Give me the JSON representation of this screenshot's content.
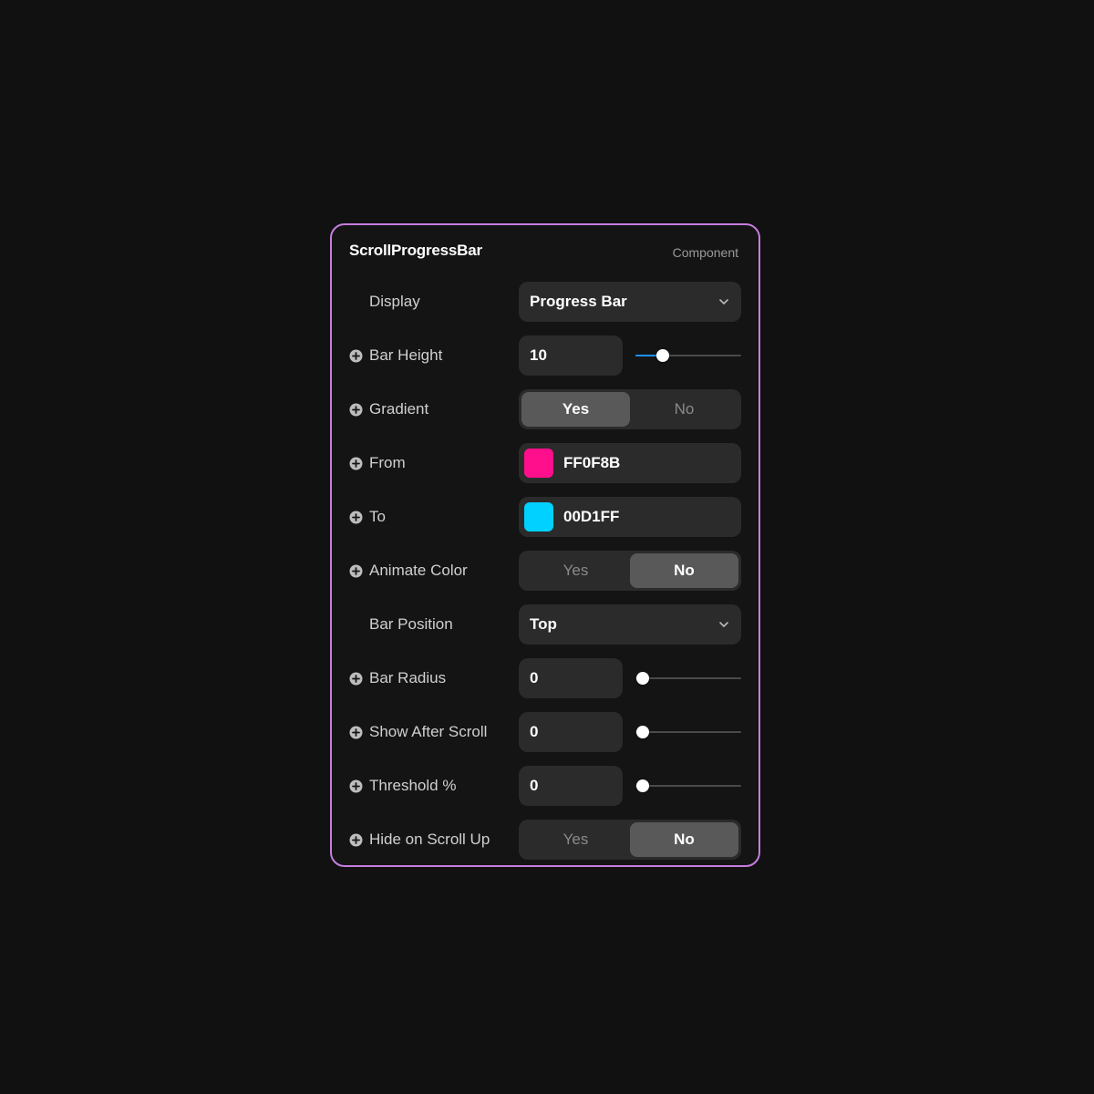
{
  "panel": {
    "title": "ScrollProgressBar",
    "subtitle": "Component",
    "border_color": "#c77de0",
    "accent_color": "#1e90ff"
  },
  "rows": {
    "display": {
      "label": "Display",
      "value": "Progress Bar",
      "icon": "chevron-down-icon"
    },
    "bar_height": {
      "label": "Bar Height",
      "value": "10",
      "slider_fraction": 0.22
    },
    "gradient": {
      "label": "Gradient",
      "options": [
        "Yes",
        "No"
      ],
      "selected": "Yes"
    },
    "from": {
      "label": "From",
      "hex": "FF0F8B",
      "swatch_color": "#FF0F8B"
    },
    "to": {
      "label": "To",
      "hex": "00D1FF",
      "swatch_color": "#00D1FF"
    },
    "animate_color": {
      "label": "Animate Color",
      "options": [
        "Yes",
        "No"
      ],
      "selected": "No"
    },
    "bar_position": {
      "label": "Bar Position",
      "value": "Top",
      "icon": "chevron-down-icon"
    },
    "bar_radius": {
      "label": "Bar Radius",
      "value": "0",
      "slider_fraction": 0
    },
    "show_after_scroll": {
      "label": "Show After Scroll",
      "value": "0",
      "slider_fraction": 0
    },
    "threshold": {
      "label": "Threshold %",
      "value": "0",
      "slider_fraction": 0
    },
    "hide_on_scroll_up": {
      "label": "Hide on Scroll Up",
      "options": [
        "Yes",
        "No"
      ],
      "selected": "No"
    }
  },
  "icons": {
    "row_add": "plus-circle-icon"
  }
}
